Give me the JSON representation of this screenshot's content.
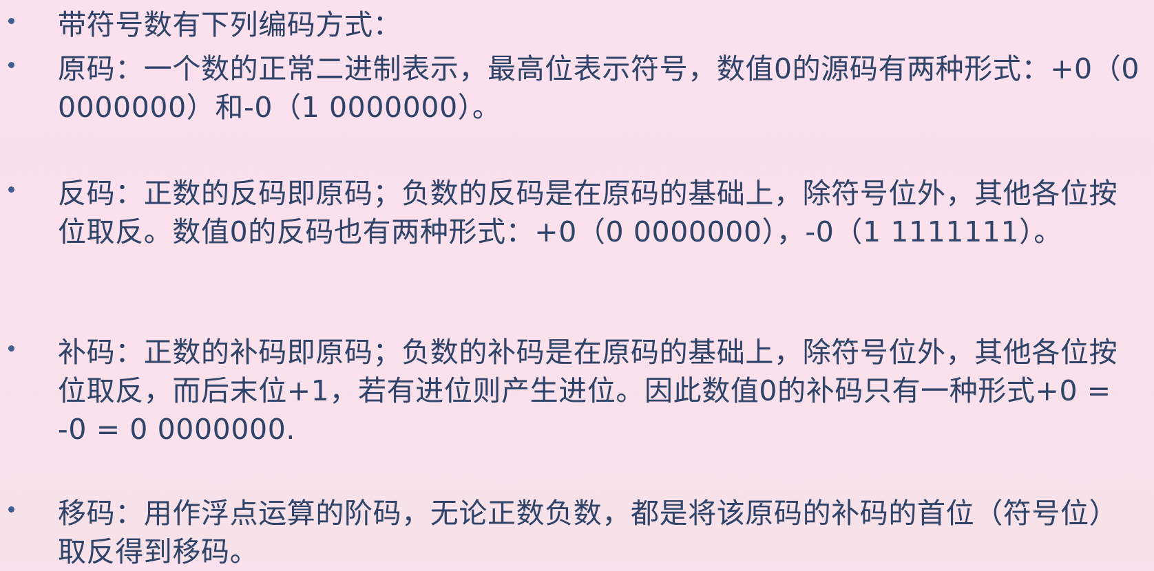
{
  "slide": {
    "items": [
      {
        "text": "带符号数有下列编码方式："
      },
      {
        "text": "原码：一个数的正常二进制表示，最高位表示符号，数值0的源码有两种形式：+0（0 0000000）和-0（1 0000000）。"
      },
      {
        "text": "反码：正数的反码即原码；负数的反码是在原码的基础上，除符号位外，其他各位按位取反。数值0的反码也有两种形式：+0（0 0000000），-0（1 1111111）。"
      },
      {
        "text": "补码：正数的补码即原码；负数的补码是在原码的基础上，除符号位外，其他各位按位取反，而后末位+1，若有进位则产生进位。因此数值0的补码只有一种形式+0 = -0 = 0 0000000."
      },
      {
        "text": "移码：用作浮点运算的阶码，无论正数负数，都是将该原码的补码的首位（符号位）取反得到移码。"
      }
    ]
  },
  "colors": {
    "background": "#fbe0ee",
    "text": "#2f4468",
    "bullet": "#3f5d8f"
  }
}
